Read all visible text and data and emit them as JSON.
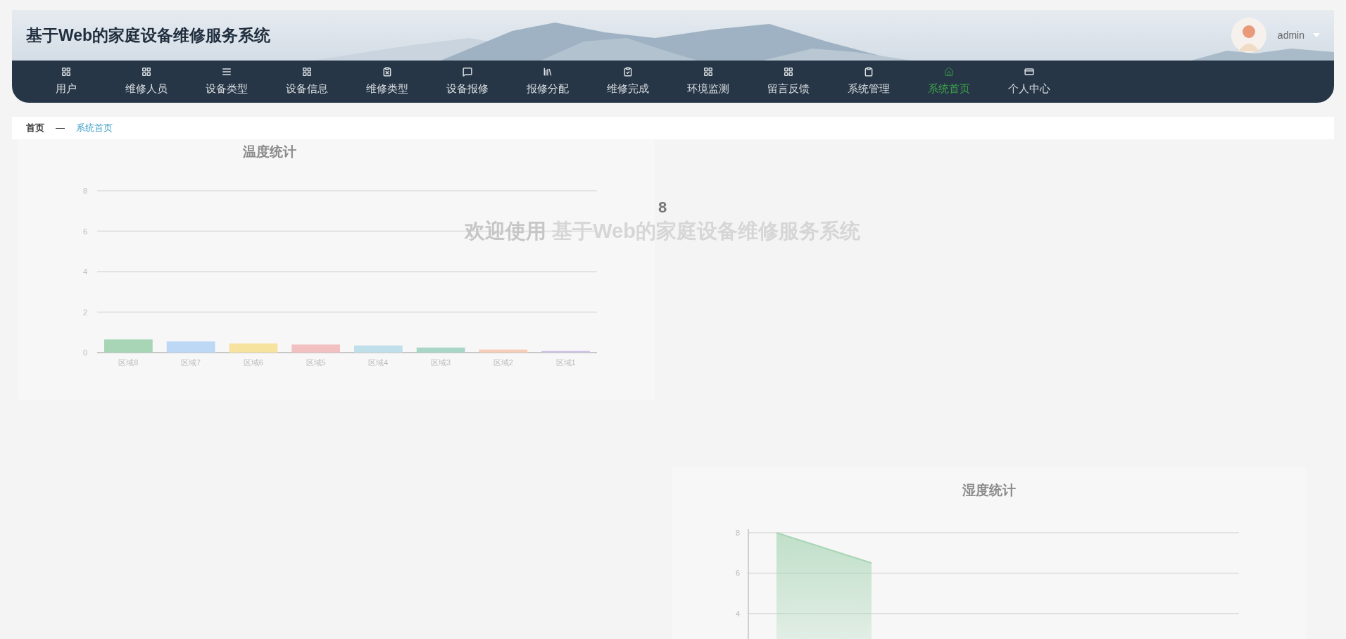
{
  "header": {
    "title": "基于Web的家庭设备维修服务系统",
    "user": "admin"
  },
  "nav": {
    "items": [
      {
        "label": "用户",
        "selected": false
      },
      {
        "label": "维修人员",
        "selected": false
      },
      {
        "label": "设备类型",
        "selected": false
      },
      {
        "label": "设备信息",
        "selected": false
      },
      {
        "label": "维修类型",
        "selected": false
      },
      {
        "label": "设备报修",
        "selected": false
      },
      {
        "label": "报修分配",
        "selected": false
      },
      {
        "label": "维修完成",
        "selected": false
      },
      {
        "label": "环境监测",
        "selected": false
      },
      {
        "label": "留言反馈",
        "selected": false
      },
      {
        "label": "系统管理",
        "selected": false
      },
      {
        "label": "系统首页",
        "selected": true
      },
      {
        "label": "个人中心",
        "selected": false
      }
    ]
  },
  "breadcrumb": {
    "home": "首页",
    "separator": "—",
    "current": "系统首页"
  },
  "welcome": {
    "lead": "欢迎使用",
    "system": "基于Web的家庭设备维修服务系统",
    "count": "8"
  },
  "temperature_chart": {
    "chart_data": {
      "type": "bar",
      "title": "温度统计",
      "categories": [
        "区域8",
        "区域7",
        "区域6",
        "区域5",
        "区域4",
        "区域3",
        "区域2",
        "区域1"
      ],
      "grid": true,
      "series": [
        {
          "color": "#a8d5b5",
          "values": [
            0.65,
            null,
            null,
            null,
            null,
            null,
            null,
            null
          ]
        },
        {
          "color": "#bcd8f5",
          "values": [
            null,
            0.55,
            null,
            null,
            null,
            null,
            null,
            null
          ]
        },
        {
          "color": "#f7e3a0",
          "values": [
            null,
            null,
            0.45,
            null,
            null,
            null,
            null,
            null
          ]
        },
        {
          "color": "#f2c0c0",
          "values": [
            null,
            null,
            null,
            0.4,
            null,
            null,
            null,
            null
          ]
        },
        {
          "color": "#bfe0ea",
          "values": [
            null,
            null,
            null,
            null,
            0.35,
            null,
            null,
            null
          ]
        },
        {
          "color": "#a9d6c6",
          "values": [
            null,
            null,
            null,
            null,
            null,
            0.25,
            null,
            null
          ]
        },
        {
          "color": "#f5cdb8",
          "values": [
            null,
            null,
            null,
            null,
            null,
            null,
            0.15,
            null
          ]
        },
        {
          "color": "#cfc4e6",
          "values": [
            null,
            null,
            null,
            null,
            null,
            null,
            null,
            0.08
          ]
        }
      ],
      "ylim": [
        0,
        8
      ],
      "yticks": [
        0,
        2,
        4,
        6,
        8
      ]
    }
  },
  "humidity_chart": {
    "chart_data": {
      "type": "area",
      "title": "湿度统计",
      "grid": true,
      "categories": [
        null,
        null,
        null,
        null,
        null
      ],
      "series": [
        {
          "color": "#a8d5b5",
          "values": [
            8,
            6.5,
            null,
            null,
            null
          ]
        }
      ],
      "ylim": [
        0,
        8
      ],
      "yticks": [
        4,
        6,
        8
      ]
    }
  }
}
